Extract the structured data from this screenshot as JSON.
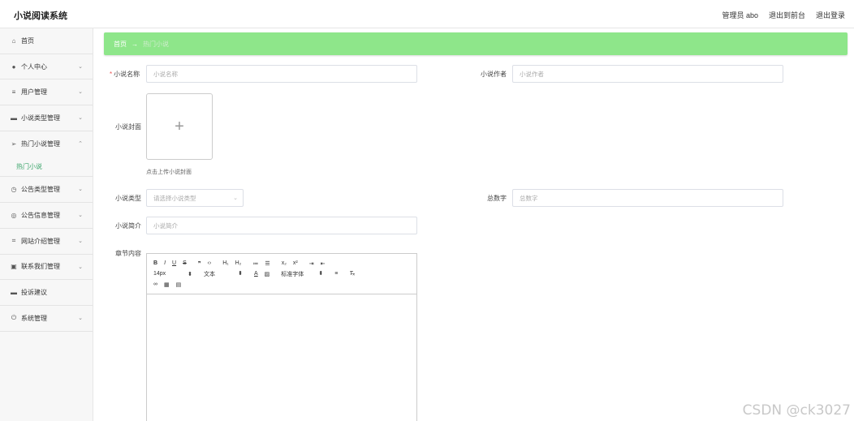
{
  "header": {
    "app_title": "小说阅读系统",
    "admin_label": "管理员 abo",
    "frontend_link": "退出到前台",
    "logout_link": "退出登录"
  },
  "sidebar": {
    "items": [
      {
        "label": "首页",
        "icon": "home-icon"
      },
      {
        "label": "个人中心",
        "icon": "user-icon"
      },
      {
        "label": "用户管理",
        "icon": "list-icon"
      },
      {
        "label": "小说类型管理",
        "icon": "monitor-icon"
      },
      {
        "label": "热门小说管理",
        "icon": "send-icon"
      },
      {
        "label": "公告类型管理",
        "icon": "clock-icon"
      },
      {
        "label": "公告信息管理",
        "icon": "dashboard-icon"
      },
      {
        "label": "网站介绍管理",
        "icon": "crop-icon"
      },
      {
        "label": "联系我们管理",
        "icon": "clipboard-icon"
      },
      {
        "label": "投诉建议",
        "icon": "monitor-icon"
      },
      {
        "label": "系统管理",
        "icon": "power-icon"
      }
    ],
    "sub_item": "热门小说"
  },
  "breadcrumb": {
    "home": "首页",
    "separator": "→",
    "current": "热门小说"
  },
  "form": {
    "name_label": "小说名称",
    "name_placeholder": "小说名称",
    "author_label": "小说作者",
    "author_placeholder": "小说作者",
    "cover_label": "小说封面",
    "cover_tip": "点击上传小说封面",
    "type_label": "小说类型",
    "type_placeholder": "请选择小说类型",
    "words_label": "总数字",
    "words_placeholder": "总数字",
    "intro_label": "小说简介",
    "intro_placeholder": "小说简介",
    "content_label": "章节内容"
  },
  "editor": {
    "font_size": "14px",
    "text_type": "文本",
    "font_family": "标准字体"
  },
  "watermark": "CSDN @ck3027"
}
